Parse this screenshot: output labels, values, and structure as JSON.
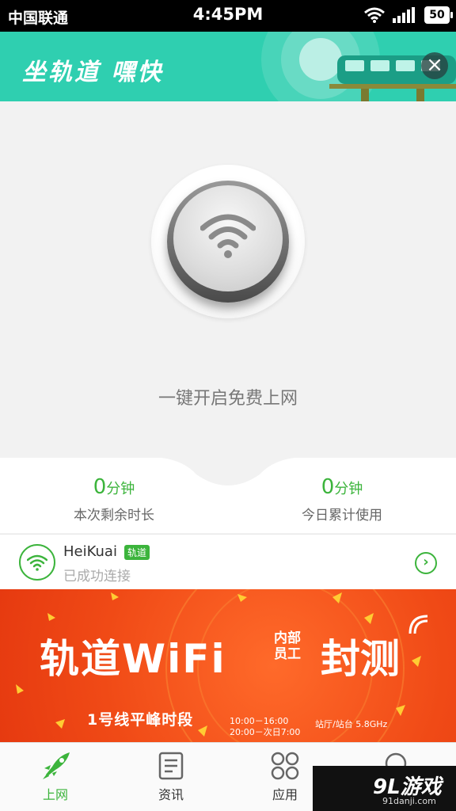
{
  "status_bar": {
    "carrier": "中国联通",
    "time": "4:45PM",
    "battery": "50"
  },
  "banner": {
    "tagline": "坐轨道 嘿快",
    "close_icon": "close-icon",
    "accent_color": "#2fcfb0"
  },
  "main": {
    "connect_hint": "一键开启免费上网"
  },
  "stats": {
    "remaining": {
      "value": "0",
      "unit": "分钟",
      "label": "本次剩余时长"
    },
    "today": {
      "value": "0",
      "unit": "分钟",
      "label": "今日累计使用"
    },
    "accent_color": "#3cb43c"
  },
  "network": {
    "name": "HeiKuai",
    "tag": "轨道",
    "status": "已成功连接"
  },
  "promo": {
    "title": "轨道WiFi",
    "sub_line1": "内部",
    "sub_line2": "员工",
    "title2": "封测",
    "line": "1号线平峰时段",
    "time1": "10:00－16:00",
    "time2": "20:00－次日7:00",
    "spec": "站厅/站台  5.8GHz"
  },
  "tabs": [
    {
      "label": "上网",
      "icon": "rocket-icon",
      "active": true
    },
    {
      "label": "资讯",
      "icon": "news-icon",
      "active": false
    },
    {
      "label": "应用",
      "icon": "apps-icon",
      "active": false
    }
  ],
  "watermark": {
    "logo": "9L游戏",
    "url": "91danji.com"
  }
}
